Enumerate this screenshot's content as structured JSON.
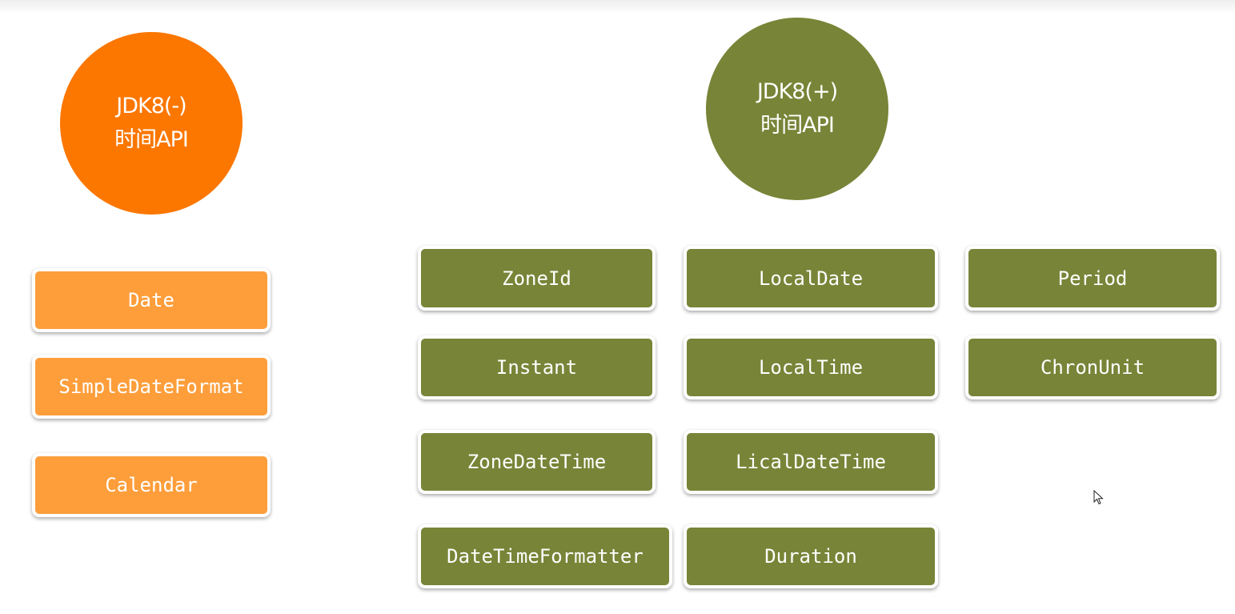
{
  "left_group": {
    "circle": {
      "line1": "JDK8(-)",
      "line2": "时间API"
    },
    "boxes": [
      "Date",
      "SimpleDateFormat",
      "Calendar"
    ]
  },
  "right_group": {
    "circle": {
      "line1": "JDK8(+)",
      "line2": "时间API"
    },
    "boxes": [
      "ZoneId",
      "LocalDate",
      "Period",
      "Instant",
      "LocalTime",
      "ChronUnit",
      "ZoneDateTime",
      "LicalDateTime",
      "DateTimeFormatter",
      "Duration"
    ]
  },
  "colors": {
    "legacy_circle": "#fb7700",
    "legacy_box": "#fd9e3b",
    "modern": "#788437"
  }
}
